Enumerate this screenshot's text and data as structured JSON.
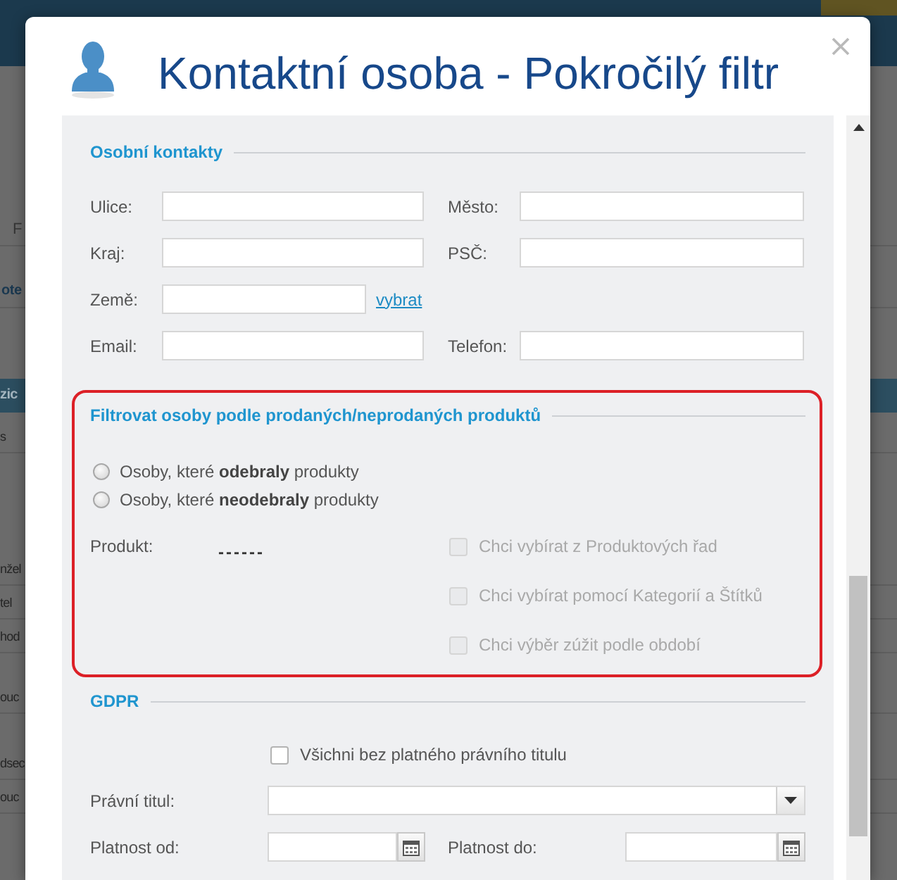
{
  "background_page": {
    "rows": [
      {
        "kind": "label",
        "text": "F"
      },
      {
        "kind": "link",
        "text": "ote"
      },
      {
        "kind": "header",
        "text": "zic"
      },
      {
        "kind": "cell",
        "text": "s"
      },
      {
        "kind": "cell",
        "text": "nžel"
      },
      {
        "kind": "cell",
        "text": "tel"
      },
      {
        "kind": "cell",
        "text": "hod"
      },
      {
        "kind": "cell",
        "text": "ouc"
      },
      {
        "kind": "cell",
        "text": "dsec"
      },
      {
        "kind": "cell",
        "text": "ouc"
      }
    ]
  },
  "dialog": {
    "title": "Kontaktní osoba - Pokročilý filtr"
  },
  "personal_contacts": {
    "title": "Osobní kontakty",
    "rows": [
      [
        {
          "label": "Ulice:"
        },
        {
          "label": "Město:"
        }
      ],
      [
        {
          "label": "Kraj:"
        },
        {
          "label": "PSČ:"
        }
      ],
      [
        {
          "label": "Země:",
          "link": "vybrat"
        }
      ],
      [
        {
          "label": "Email:"
        },
        {
          "label": "Telefon:"
        }
      ]
    ]
  },
  "product_filter": {
    "title": "Filtrovat osoby podle prodaných/neprodaných produktů",
    "highlighted": true,
    "options": [
      {
        "label": "Osoby, které **odebraly** produkty",
        "selected": false
      },
      {
        "label": "Osoby, které **neodebraly** produkty",
        "selected": false
      }
    ],
    "product": {
      "label": "Produkt:",
      "value": "------"
    },
    "checks": [
      {
        "label": "Chci vybírat z Produktových řad",
        "checked": false,
        "disabled": true
      },
      {
        "label": "Chci vybírat pomocí Kategorií a Štítků",
        "checked": false,
        "disabled": true
      },
      {
        "label": "Chci výběr zúžit podle období",
        "checked": false,
        "disabled": true
      }
    ]
  },
  "gdpr": {
    "title": "GDPR",
    "check": {
      "label": "Všichni bez platného právního titulu",
      "checked": false,
      "disabled": false
    },
    "legal_title": {
      "label": "Právní titul:"
    },
    "valid_from": {
      "label": "Platnost od:"
    },
    "valid_to": {
      "label": "Platnost do:"
    }
  }
}
